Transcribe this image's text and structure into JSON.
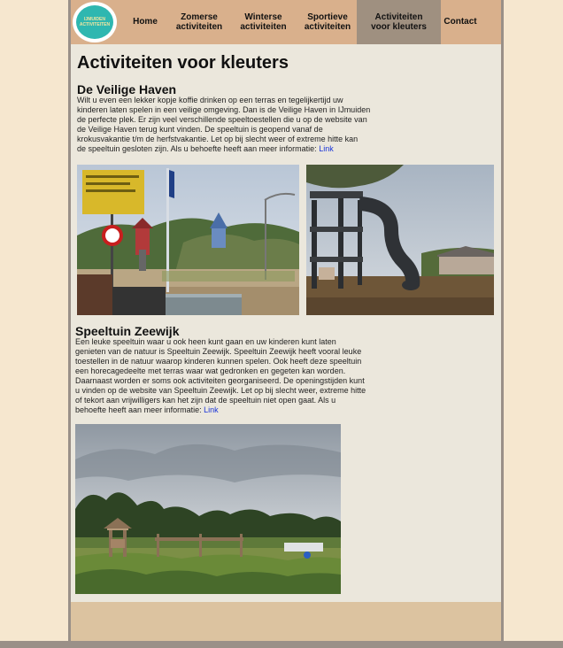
{
  "nav": {
    "logo_line1": "IJMUIDEN",
    "logo_line2": "ACTIVITEITEN",
    "items": [
      {
        "line1": "Home",
        "line2": ""
      },
      {
        "line1": "Zomerse",
        "line2": "activiteiten"
      },
      {
        "line1": "Winterse",
        "line2": "activiteiten"
      },
      {
        "line1": "Sportieve",
        "line2": "activiteiten"
      },
      {
        "line1": "Activiteiten",
        "line2": "voor kleuters"
      },
      {
        "line1": "Contact",
        "line2": ""
      }
    ],
    "active_index": 4
  },
  "page": {
    "title": "Activiteiten voor kleuters"
  },
  "sections": [
    {
      "heading": "De Veilige Haven",
      "lines": [
        "Wilt u even een lekker kopje koffie drinken op een terras en tegelijkertijd uw",
        "kinderen laten spelen in een veilige omgeving. Dan is de Veilige Haven in IJmuiden",
        "de perfecte plek. Er zijn veel verschillende speeltoestellen die u op de website van",
        "de Veilige Haven terug kunt vinden. De speeltuin is geopend vanaf de",
        "krokusvakantie t/m de herfstvakantie. Let op bij slecht weer of extreme hitte kan",
        "de speeltuin gesloten zijn. Als u behoefte heeft aan meer informatie: "
      ],
      "link": "Link"
    },
    {
      "heading": "Speeltuin Zeewijk",
      "lines": [
        "Een leuke speeltuin waar u ook heen kunt gaan en uw kinderen kunt laten",
        "genieten van de natuur is Speeltuin Zeewijk. Speeltuin Zeewijk heeft vooral leuke",
        "toestellen in de natuur waarop kinderen kunnen spelen. Ook heeft deze speeltuin",
        "een horecagedeelte met terras waar wat gedronken en gegeten kan worden.",
        "Daarnaast worden er soms ook activiteiten georganiseerd. De openingstijden kunt",
        "u vinden op de website van Speeltuin Zeewijk. Let op bij slecht weer, extreme hitte",
        "of tekort aan vrijwilligers kan het zijn dat de speeltuin niet open gaat. Als u",
        "behoefte heeft aan meer informatie: "
      ],
      "link": "Link"
    }
  ],
  "colors": {
    "background": "#f6e7cf",
    "nav": "#d9b08c",
    "nav_active": "#9f9080",
    "content": "#ebe7dc",
    "link": "#1a35d8"
  }
}
